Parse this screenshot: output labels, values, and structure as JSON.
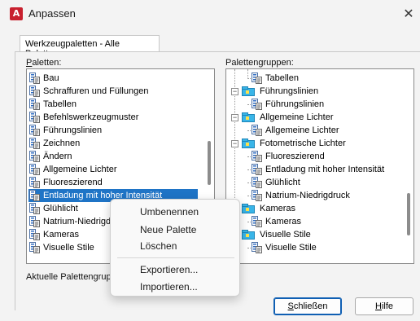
{
  "window": {
    "title": "Anpassen",
    "app_icon_letter": "A",
    "close_glyph": "✕",
    "accent_color": "#c8202e"
  },
  "tab": {
    "label": "Werkzeugpaletten - Alle Paletten"
  },
  "palettes": {
    "label": "Paletten:",
    "label_mnemonic": "P",
    "label_rest": "aletten:",
    "selected_index": 9,
    "selection_color": "#1f74c6",
    "items": [
      {
        "label": "Bau",
        "icon": "palette-icon"
      },
      {
        "label": "Schraffuren und Füllungen",
        "icon": "palette-icon"
      },
      {
        "label": "Tabellen",
        "icon": "palette-icon"
      },
      {
        "label": "Befehlswerkzeugmuster",
        "icon": "palette-icon"
      },
      {
        "label": "Führungslinien",
        "icon": "palette-icon"
      },
      {
        "label": "Zeichnen",
        "icon": "palette-icon"
      },
      {
        "label": "Ändern",
        "icon": "palette-icon"
      },
      {
        "label": "Allgemeine Lichter",
        "icon": "palette-icon"
      },
      {
        "label": "Fluoreszierend",
        "icon": "palette-icon"
      },
      {
        "label": "Entladung mit hoher Intensität",
        "icon": "palette-icon"
      },
      {
        "label": "Glühlicht",
        "icon": "palette-icon"
      },
      {
        "label": "Natrium-Niedrigdruck",
        "icon": "palette-icon"
      },
      {
        "label": "Kameras",
        "icon": "palette-icon"
      },
      {
        "label": "Visuelle Stile",
        "icon": "palette-icon"
      }
    ]
  },
  "groups": {
    "label": "Palettengruppen:",
    "label_mnemonic": "g",
    "label_pre": "Paletten",
    "label_post": "ruppen:",
    "items": [
      {
        "label": "Tabellen",
        "level": 1,
        "type": "palette"
      },
      {
        "label": "Führungslinien",
        "level": 0,
        "type": "group",
        "expander": "−"
      },
      {
        "label": "Führungslinien",
        "level": 1,
        "type": "palette"
      },
      {
        "label": "Allgemeine Lichter",
        "level": 0,
        "type": "group",
        "expander": "−"
      },
      {
        "label": "Allgemeine Lichter",
        "level": 1,
        "type": "palette"
      },
      {
        "label": "Fotometrische Lichter",
        "level": 0,
        "type": "group",
        "expander": "−"
      },
      {
        "label": "Fluoreszierend",
        "level": 1,
        "type": "palette"
      },
      {
        "label": "Entladung mit hoher Intensität",
        "level": 1,
        "type": "palette"
      },
      {
        "label": "Glühlicht",
        "level": 1,
        "type": "palette"
      },
      {
        "label": "Natrium-Niedrigdruck",
        "level": 1,
        "type": "palette"
      },
      {
        "label": "Kameras",
        "level": 0,
        "type": "group",
        "expander": "−"
      },
      {
        "label": "Kameras",
        "level": 1,
        "type": "palette"
      },
      {
        "label": "Visuelle Stile",
        "level": 0,
        "type": "group",
        "expander": "−"
      },
      {
        "label": "Visuelle Stile",
        "level": 1,
        "type": "palette"
      }
    ]
  },
  "current_group": {
    "label": "Aktuelle Palettengrupp"
  },
  "buttons": {
    "close_label": "Schließen",
    "close_mnemonic": "S",
    "close_rest": "chließen",
    "help_label": "Hilfe",
    "help_mnemonic": "H",
    "help_rest": "ilfe"
  },
  "context_menu": {
    "items": [
      {
        "label": "Umbenennen"
      },
      {
        "label": "Neue Palette"
      },
      {
        "label": "Löschen"
      },
      {
        "label": "Exportieren..."
      },
      {
        "label": "Importieren..."
      }
    ]
  }
}
